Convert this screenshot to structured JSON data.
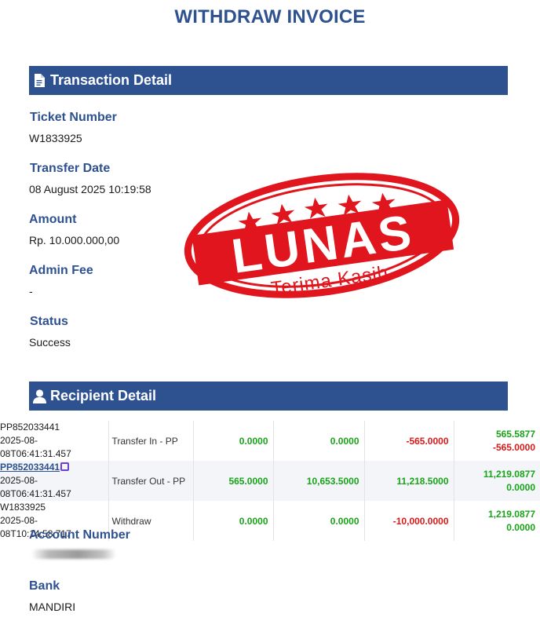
{
  "page": {
    "title": "WITHDRAW INVOICE"
  },
  "transaction": {
    "header": "Transaction Detail",
    "ticket_label": "Ticket Number",
    "ticket_value": "W1833925",
    "date_label": "Transfer Date",
    "date_value": "08 August 2025 10:19:58",
    "amount_label": "Amount",
    "amount_value": "Rp. 10.000.000,00",
    "fee_label": "Admin Fee",
    "fee_value": "-",
    "status_label": "Status",
    "status_value": "Success"
  },
  "stamp": {
    "main": "LUNAS",
    "sub": "Terima Kasih"
  },
  "recipient": {
    "header": "Recipient Detail",
    "rows": [
      {
        "ref": "PP852033441",
        "time": "2025-08-08T06:41:31.457",
        "type": "Transfer In - PP",
        "a": "0.0000",
        "b": "0.0000",
        "c": "-565.0000",
        "d1": "565.5877",
        "d2": "-565.0000"
      },
      {
        "ref": "PP852033441",
        "time": "2025-08-08T06:41:31.457",
        "type": "Transfer Out - PP",
        "a": "565.0000",
        "b": "10,653.5000",
        "c": "11,218.5000",
        "d1": "11,219.0877",
        "d2": "0.0000"
      },
      {
        "ref": "W1833925",
        "time": "2025-08-08T10:14:58.717",
        "type": "Withdraw",
        "a": "0.0000",
        "b": "0.0000",
        "c": "-10,000.0000",
        "d1": "1,219.0877",
        "d2": "0.0000"
      }
    ],
    "account_label": "Account Number",
    "bank_label": "Bank",
    "bank_value": "MANDIRI"
  },
  "colors": {
    "primary": "#2e5190",
    "green": "#19a319",
    "red": "#d61a1a",
    "stamp_red": "#e0151d"
  },
  "icons": {
    "transaction": "document-icon",
    "recipient": "user-icon",
    "copy": "copy-icon"
  }
}
